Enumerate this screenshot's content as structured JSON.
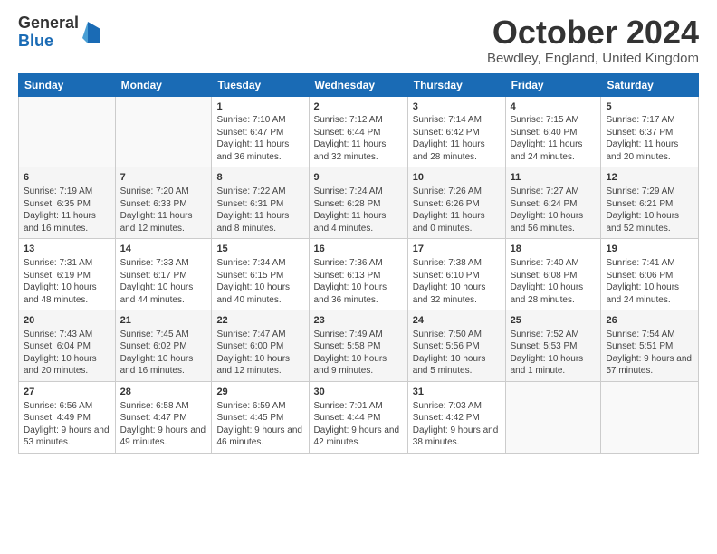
{
  "logo": {
    "general": "General",
    "blue": "Blue"
  },
  "header": {
    "month": "October 2024",
    "location": "Bewdley, England, United Kingdom"
  },
  "days_of_week": [
    "Sunday",
    "Monday",
    "Tuesday",
    "Wednesday",
    "Thursday",
    "Friday",
    "Saturday"
  ],
  "weeks": [
    [
      {
        "day": "",
        "sunrise": "",
        "sunset": "",
        "daylight": ""
      },
      {
        "day": "",
        "sunrise": "",
        "sunset": "",
        "daylight": ""
      },
      {
        "day": "1",
        "sunrise": "Sunrise: 7:10 AM",
        "sunset": "Sunset: 6:47 PM",
        "daylight": "Daylight: 11 hours and 36 minutes."
      },
      {
        "day": "2",
        "sunrise": "Sunrise: 7:12 AM",
        "sunset": "Sunset: 6:44 PM",
        "daylight": "Daylight: 11 hours and 32 minutes."
      },
      {
        "day": "3",
        "sunrise": "Sunrise: 7:14 AM",
        "sunset": "Sunset: 6:42 PM",
        "daylight": "Daylight: 11 hours and 28 minutes."
      },
      {
        "day": "4",
        "sunrise": "Sunrise: 7:15 AM",
        "sunset": "Sunset: 6:40 PM",
        "daylight": "Daylight: 11 hours and 24 minutes."
      },
      {
        "day": "5",
        "sunrise": "Sunrise: 7:17 AM",
        "sunset": "Sunset: 6:37 PM",
        "daylight": "Daylight: 11 hours and 20 minutes."
      }
    ],
    [
      {
        "day": "6",
        "sunrise": "Sunrise: 7:19 AM",
        "sunset": "Sunset: 6:35 PM",
        "daylight": "Daylight: 11 hours and 16 minutes."
      },
      {
        "day": "7",
        "sunrise": "Sunrise: 7:20 AM",
        "sunset": "Sunset: 6:33 PM",
        "daylight": "Daylight: 11 hours and 12 minutes."
      },
      {
        "day": "8",
        "sunrise": "Sunrise: 7:22 AM",
        "sunset": "Sunset: 6:31 PM",
        "daylight": "Daylight: 11 hours and 8 minutes."
      },
      {
        "day": "9",
        "sunrise": "Sunrise: 7:24 AM",
        "sunset": "Sunset: 6:28 PM",
        "daylight": "Daylight: 11 hours and 4 minutes."
      },
      {
        "day": "10",
        "sunrise": "Sunrise: 7:26 AM",
        "sunset": "Sunset: 6:26 PM",
        "daylight": "Daylight: 11 hours and 0 minutes."
      },
      {
        "day": "11",
        "sunrise": "Sunrise: 7:27 AM",
        "sunset": "Sunset: 6:24 PM",
        "daylight": "Daylight: 10 hours and 56 minutes."
      },
      {
        "day": "12",
        "sunrise": "Sunrise: 7:29 AM",
        "sunset": "Sunset: 6:21 PM",
        "daylight": "Daylight: 10 hours and 52 minutes."
      }
    ],
    [
      {
        "day": "13",
        "sunrise": "Sunrise: 7:31 AM",
        "sunset": "Sunset: 6:19 PM",
        "daylight": "Daylight: 10 hours and 48 minutes."
      },
      {
        "day": "14",
        "sunrise": "Sunrise: 7:33 AM",
        "sunset": "Sunset: 6:17 PM",
        "daylight": "Daylight: 10 hours and 44 minutes."
      },
      {
        "day": "15",
        "sunrise": "Sunrise: 7:34 AM",
        "sunset": "Sunset: 6:15 PM",
        "daylight": "Daylight: 10 hours and 40 minutes."
      },
      {
        "day": "16",
        "sunrise": "Sunrise: 7:36 AM",
        "sunset": "Sunset: 6:13 PM",
        "daylight": "Daylight: 10 hours and 36 minutes."
      },
      {
        "day": "17",
        "sunrise": "Sunrise: 7:38 AM",
        "sunset": "Sunset: 6:10 PM",
        "daylight": "Daylight: 10 hours and 32 minutes."
      },
      {
        "day": "18",
        "sunrise": "Sunrise: 7:40 AM",
        "sunset": "Sunset: 6:08 PM",
        "daylight": "Daylight: 10 hours and 28 minutes."
      },
      {
        "day": "19",
        "sunrise": "Sunrise: 7:41 AM",
        "sunset": "Sunset: 6:06 PM",
        "daylight": "Daylight: 10 hours and 24 minutes."
      }
    ],
    [
      {
        "day": "20",
        "sunrise": "Sunrise: 7:43 AM",
        "sunset": "Sunset: 6:04 PM",
        "daylight": "Daylight: 10 hours and 20 minutes."
      },
      {
        "day": "21",
        "sunrise": "Sunrise: 7:45 AM",
        "sunset": "Sunset: 6:02 PM",
        "daylight": "Daylight: 10 hours and 16 minutes."
      },
      {
        "day": "22",
        "sunrise": "Sunrise: 7:47 AM",
        "sunset": "Sunset: 6:00 PM",
        "daylight": "Daylight: 10 hours and 12 minutes."
      },
      {
        "day": "23",
        "sunrise": "Sunrise: 7:49 AM",
        "sunset": "Sunset: 5:58 PM",
        "daylight": "Daylight: 10 hours and 9 minutes."
      },
      {
        "day": "24",
        "sunrise": "Sunrise: 7:50 AM",
        "sunset": "Sunset: 5:56 PM",
        "daylight": "Daylight: 10 hours and 5 minutes."
      },
      {
        "day": "25",
        "sunrise": "Sunrise: 7:52 AM",
        "sunset": "Sunset: 5:53 PM",
        "daylight": "Daylight: 10 hours and 1 minute."
      },
      {
        "day": "26",
        "sunrise": "Sunrise: 7:54 AM",
        "sunset": "Sunset: 5:51 PM",
        "daylight": "Daylight: 9 hours and 57 minutes."
      }
    ],
    [
      {
        "day": "27",
        "sunrise": "Sunrise: 6:56 AM",
        "sunset": "Sunset: 4:49 PM",
        "daylight": "Daylight: 9 hours and 53 minutes."
      },
      {
        "day": "28",
        "sunrise": "Sunrise: 6:58 AM",
        "sunset": "Sunset: 4:47 PM",
        "daylight": "Daylight: 9 hours and 49 minutes."
      },
      {
        "day": "29",
        "sunrise": "Sunrise: 6:59 AM",
        "sunset": "Sunset: 4:45 PM",
        "daylight": "Daylight: 9 hours and 46 minutes."
      },
      {
        "day": "30",
        "sunrise": "Sunrise: 7:01 AM",
        "sunset": "Sunset: 4:44 PM",
        "daylight": "Daylight: 9 hours and 42 minutes."
      },
      {
        "day": "31",
        "sunrise": "Sunrise: 7:03 AM",
        "sunset": "Sunset: 4:42 PM",
        "daylight": "Daylight: 9 hours and 38 minutes."
      },
      {
        "day": "",
        "sunrise": "",
        "sunset": "",
        "daylight": ""
      },
      {
        "day": "",
        "sunrise": "",
        "sunset": "",
        "daylight": ""
      }
    ]
  ]
}
